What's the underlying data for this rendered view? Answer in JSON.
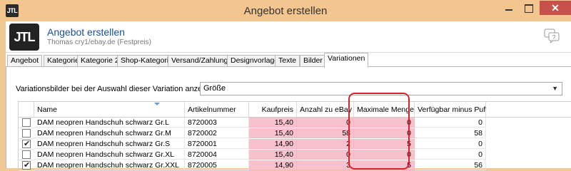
{
  "window": {
    "title": "Angebot erstellen",
    "app_icon_text": "JTL",
    "close_glyph": "✕"
  },
  "header": {
    "logo_text": "JTL",
    "title": "Angebot erstellen",
    "subtitle": "Thomas cry1/ebay.de (Festpreis)"
  },
  "tabs": [
    {
      "label": "Angebot"
    },
    {
      "label": "Kategorie"
    },
    {
      "label": "Kategorie 2"
    },
    {
      "label": "Shop-Kategorie"
    },
    {
      "label": "Versand/Zahlung"
    },
    {
      "label": "Designvorlage"
    },
    {
      "label": "Texte"
    },
    {
      "label": "Bilder"
    },
    {
      "label": "Variationen"
    }
  ],
  "active_tab": "Variationen",
  "variations": {
    "label": "Variationsbilder bei der Auswahl dieser Variation anzeigen:",
    "selected": "Größe"
  },
  "grid": {
    "columns": [
      "Name",
      "Artikelnummer",
      "Kaufpreis",
      "Anzahl zu eBay",
      "Maximale Menge",
      "Verfügbar minus Puffer"
    ],
    "rows": [
      {
        "checked": false,
        "name": "DAM neopren Handschuh schwarz Gr.L",
        "sku": "8720003",
        "price": "15,40",
        "count": "0",
        "max": "0",
        "avail": "0"
      },
      {
        "checked": false,
        "name": "DAM neopren Handschuh schwarz Gr.M",
        "sku": "8720002",
        "price": "15,40",
        "count": "58",
        "max": "0",
        "avail": "58"
      },
      {
        "checked": true,
        "name": "DAM neopren Handschuh schwarz Gr.S",
        "sku": "8720001",
        "price": "14,90",
        "count": "2",
        "max": "5",
        "avail": "0"
      },
      {
        "checked": false,
        "name": "DAM neopren Handschuh schwarz Gr.XL",
        "sku": "8720004",
        "price": "15,40",
        "count": "0",
        "max": "0",
        "avail": "0"
      },
      {
        "checked": true,
        "name": "DAM neopren Handschuh schwarz Gr.XXL",
        "sku": "8720005",
        "price": "14,90",
        "count": "3",
        "max": "5",
        "avail": "56"
      }
    ]
  },
  "colors": {
    "titlebar": "#f2c68e",
    "close_button": "#c7504a",
    "header_title": "#1a4f9c",
    "editable_cell": "#f8c2cc",
    "highlight": "#d7232c"
  },
  "icons": {
    "help": "chat-help-icon",
    "dropdown": "chevron-down-icon",
    "sort": "sort-caret-icon"
  }
}
